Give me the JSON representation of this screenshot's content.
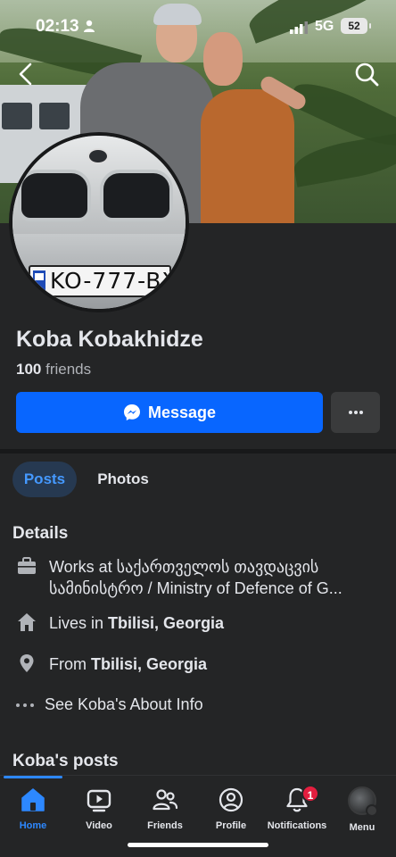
{
  "status_bar": {
    "time": "02:13",
    "network": "5G",
    "battery": "52"
  },
  "profile": {
    "name": "Koba Kobakhidze",
    "friends_count": "100",
    "friends_label": " friends",
    "plate_text": "KO-777-BX"
  },
  "actions": {
    "message_label": "Message"
  },
  "tabs": [
    {
      "label": "Posts"
    },
    {
      "label": "Photos"
    }
  ],
  "details": {
    "title": "Details",
    "work_line1": "Works at საქართველოს თავდაცვის",
    "work_line2": "სამინისტრო / Ministry of Defence of G...",
    "lives_prefix": "Lives in ",
    "lives_place": "Tbilisi, Georgia",
    "from_prefix": "From ",
    "from_place": "Tbilisi, Georgia",
    "about_label": "See Koba's About Info"
  },
  "posts_section": {
    "title": "Koba's posts"
  },
  "bottom_nav": {
    "items": [
      {
        "label": "Home",
        "icon": "home-icon"
      },
      {
        "label": "Video",
        "icon": "video-icon"
      },
      {
        "label": "Friends",
        "icon": "friends-icon"
      },
      {
        "label": "Profile",
        "icon": "profile-icon"
      },
      {
        "label": "Notifications",
        "icon": "bell-icon",
        "badge": "1"
      },
      {
        "label": "Menu",
        "icon": "menu-avatar"
      }
    ]
  },
  "colors": {
    "accent": "#0866ff",
    "active_tab_text": "#4599ff",
    "badge": "#e41e3f",
    "background": "#242526"
  }
}
